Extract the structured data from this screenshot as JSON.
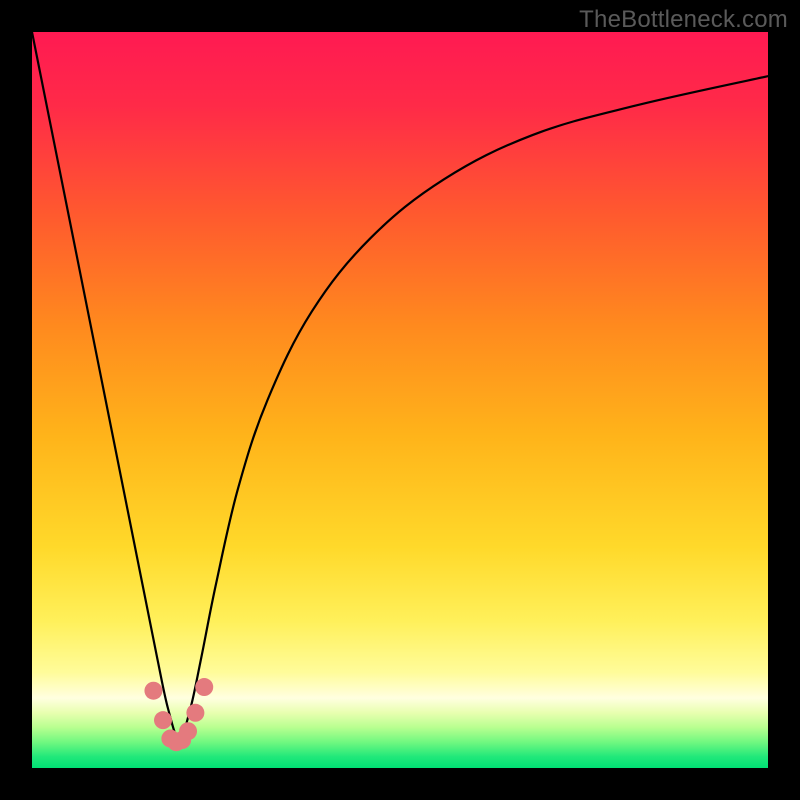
{
  "watermark": "TheBottleneck.com",
  "colors": {
    "frame": "#000000",
    "curve_stroke": "#000000",
    "marker_fill": "#e47a7e",
    "gradient_stops": [
      {
        "offset": 0.0,
        "color": "#ff1a52"
      },
      {
        "offset": 0.1,
        "color": "#ff2a48"
      },
      {
        "offset": 0.25,
        "color": "#ff5a2e"
      },
      {
        "offset": 0.4,
        "color": "#ff8a1e"
      },
      {
        "offset": 0.55,
        "color": "#ffb41a"
      },
      {
        "offset": 0.7,
        "color": "#ffd92a"
      },
      {
        "offset": 0.8,
        "color": "#fff05a"
      },
      {
        "offset": 0.87,
        "color": "#fffc9a"
      },
      {
        "offset": 0.905,
        "color": "#ffffe0"
      },
      {
        "offset": 0.925,
        "color": "#e8ffb0"
      },
      {
        "offset": 0.945,
        "color": "#b8ff90"
      },
      {
        "offset": 0.965,
        "color": "#70f880"
      },
      {
        "offset": 0.985,
        "color": "#20e87a"
      },
      {
        "offset": 1.0,
        "color": "#00e074"
      }
    ]
  },
  "chart_data": {
    "type": "line",
    "title": "",
    "xlabel": "",
    "ylabel": "",
    "xlim": [
      0,
      100
    ],
    "ylim": [
      0,
      100
    ],
    "series": [
      {
        "name": "bottleneck-curve",
        "x": [
          0,
          5,
          10,
          13,
          15,
          17,
          18.5,
          20,
          21.5,
          23,
          25,
          28,
          32,
          38,
          46,
          56,
          68,
          82,
          100
        ],
        "values": [
          100,
          75,
          50,
          35,
          25,
          15,
          8,
          4,
          8,
          15,
          25,
          38,
          50,
          62,
          72,
          80,
          86,
          90,
          94
        ]
      }
    ],
    "markers": {
      "name": "highlight-cluster",
      "x": [
        16.5,
        17.8,
        18.8,
        19.6,
        20.4,
        21.2,
        22.2,
        23.4
      ],
      "values": [
        10.5,
        6.5,
        4.0,
        3.5,
        3.8,
        5.0,
        7.5,
        11.0
      ],
      "radius_px": 9
    }
  }
}
